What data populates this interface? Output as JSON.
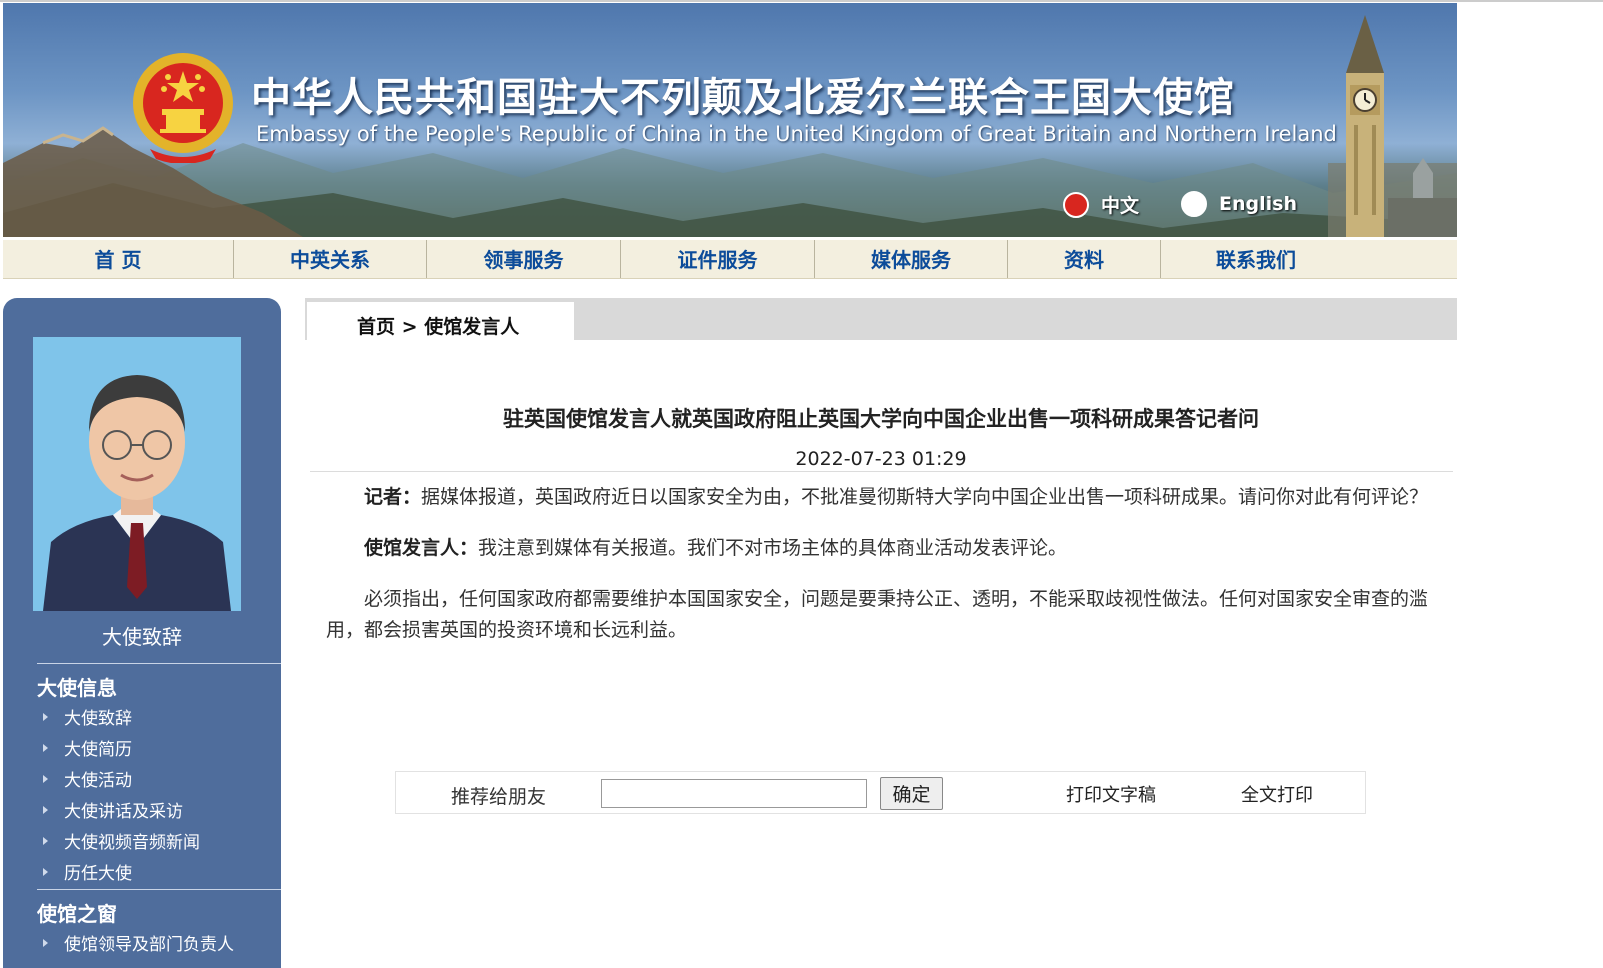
{
  "banner": {
    "title_cn": "中华人民共和国驻大不列颠及北爱尔兰联合王国大使馆",
    "title_en": "Embassy of the People's Republic of China in the United Kingdom of Great Britain and Northern Ireland",
    "lang_cn": "中文",
    "lang_en": "English"
  },
  "nav": {
    "items": [
      "首 页",
      "中英关系",
      "领事服务",
      "证件服务",
      "媒体服务",
      "资料",
      "联系我们"
    ]
  },
  "sidebar": {
    "photo_caption": "大使致辞",
    "section1_title": "大使信息",
    "section1_items": [
      "大使致辞",
      "大使简历",
      "大使活动",
      "大使讲话及采访",
      "大使视频音频新闻",
      "历任大使"
    ],
    "section2_title": "使馆之窗",
    "section2_items": [
      "使馆领导及部门负责人"
    ]
  },
  "breadcrumb": {
    "home": "首页",
    "separator": ">",
    "current": "使馆发言人"
  },
  "article": {
    "title": "驻英国使馆发言人就英国政府阻止英国大学向中国企业出售一项科研成果答记者问",
    "date": "2022-07-23 01:29",
    "q_label": "记者：",
    "q_text": "据媒体报道，英国政府近日以国家安全为由，不批准曼彻斯特大学向中国企业出售一项科研成果。请问你对此有何评论？",
    "a_label": "使馆发言人：",
    "a_text": "我注意到媒体有关报道。我们不对市场主体的具体商业活动发表评论。",
    "p3_text": "必须指出，任何国家政府都需要维护本国国家安全，问题是要秉持公正、透明，不能采取歧视性做法。任何对国家安全审查的滥用，都会损害英国的投资环境和长远利益。"
  },
  "tools": {
    "recommend_label": "推荐给朋友",
    "email_value": "",
    "confirm_label": "确定",
    "print_text_label": "打印文字稿",
    "print_full_label": "全文打印"
  },
  "colors": {
    "nav_text": "#0c4c9a",
    "sidebar_bg": "#4f6d9c",
    "nav_bg": "#f3efdf"
  }
}
